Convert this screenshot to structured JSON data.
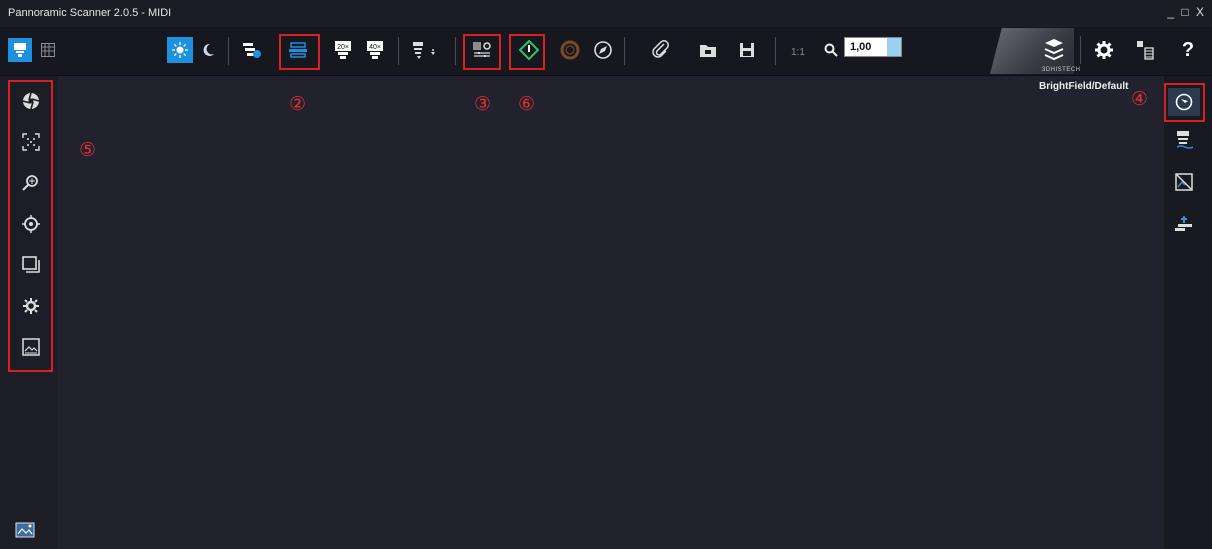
{
  "window": {
    "title": "Pannoramic Scanner 2.0.5 - MIDI",
    "controls": "_ □ X"
  },
  "toolbar": {
    "zoom_ratio_label": "1:1",
    "zoom_value": "1,00",
    "logo_text": "3DHISTECH"
  },
  "mode_label": "BrightField/Default",
  "markers": {
    "m2": "②",
    "m3": "③",
    "m4": "④",
    "m5": "⑤",
    "m6": "⑥"
  },
  "colors": {
    "accent": "#1e90e0",
    "highlight_box": "#d82222",
    "background": "#22222e",
    "start_green": "#2ec860"
  },
  "icons": {
    "left_tools": [
      "aperture-icon",
      "focus-points-icon",
      "zoom-scan-icon",
      "target-icon",
      "stack-icon",
      "gear-scan-icon",
      "image-preview-icon"
    ],
    "right_tools": [
      "compass-icon",
      "filter-icon",
      "no-image-icon",
      "stage-icon"
    ]
  }
}
